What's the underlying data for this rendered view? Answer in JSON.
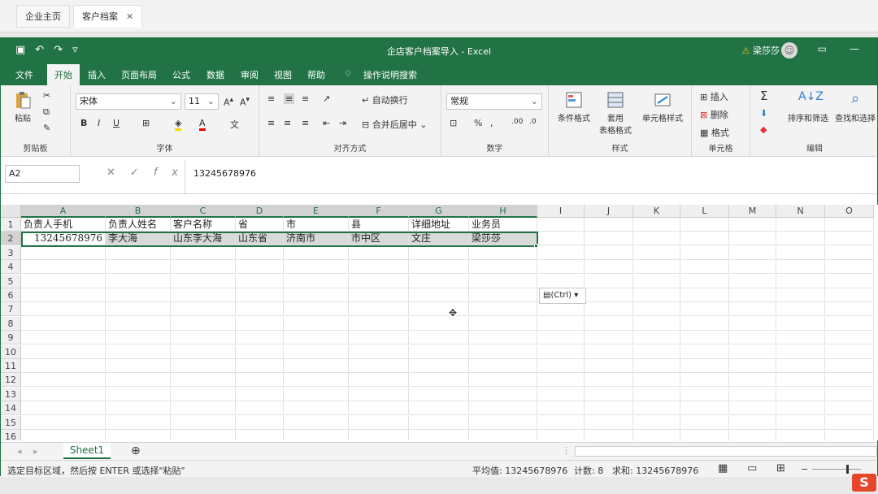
{
  "browser": {
    "tabs": [
      {
        "label": "企业主页"
      },
      {
        "label": "客户档案",
        "close": "✕"
      }
    ]
  },
  "excel": {
    "title": "企店客户档案导入 - Excel",
    "user": "梁莎莎",
    "menus": [
      "文件",
      "开始",
      "插入",
      "页面布局",
      "公式",
      "数据",
      "审阅",
      "视图",
      "帮助"
    ],
    "search": "操作说明搜索",
    "ribbon": {
      "paste": "粘贴",
      "clipboard": "剪贴板",
      "font_name": "宋体",
      "font_size": "11",
      "font_group": "字体",
      "wrap": "自动换行",
      "merge": "合并后居中",
      "align_group": "对齐方式",
      "number_format": "常规",
      "number_group": "数字",
      "cond_format": "条件格式",
      "table_format_1": "套用",
      "table_format_2": "表格格式",
      "cell_style": "单元格样式",
      "styles_group": "样式",
      "insert": "插入",
      "delete": "删除",
      "format": "格式",
      "cells_group": "单元格",
      "sort": "排序和筛选",
      "find": "查找和选择",
      "edit_group": "编辑"
    },
    "formula": {
      "cell_ref": "A2",
      "content": "13245678976"
    },
    "columns": [
      "A",
      "B",
      "C",
      "D",
      "E",
      "F",
      "G",
      "H",
      "I",
      "J",
      "K",
      "L",
      "M",
      "N",
      "O"
    ],
    "rows": [
      "1",
      "2",
      "3",
      "4",
      "5",
      "6",
      "7",
      "8",
      "9",
      "10",
      "11",
      "12",
      "13",
      "14",
      "15",
      "16"
    ],
    "table": {
      "header": [
        "负责人手机",
        "负责人姓名",
        "客户名称",
        "省",
        "市",
        "县",
        "详细地址",
        "业务员"
      ],
      "row": [
        "13245678976",
        "李大海",
        "山东李大海",
        "山东省",
        "济南市",
        "市中区",
        "文庄",
        "梁莎莎"
      ]
    },
    "paste_options": "(Ctrl)",
    "sheet": "Sheet1",
    "status": {
      "message": "选定目标区域，然后按 ENTER 或选择\"粘贴\"",
      "average": "平均值: 13245678976",
      "count": "计数: 8",
      "sum": "求和: 13245678976"
    },
    "colors": {
      "accent": "#217346"
    }
  }
}
